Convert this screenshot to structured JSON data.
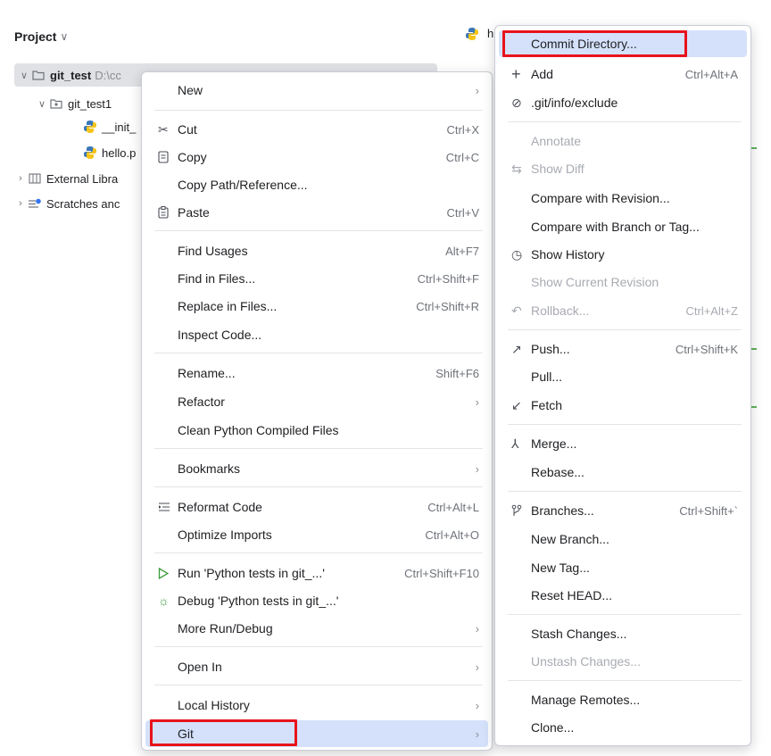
{
  "project_panel": {
    "title": "Project",
    "tree": [
      {
        "arrow": "∨",
        "label": "git_test",
        "hint": "D:\\cc",
        "icon": "folder-icon"
      },
      {
        "arrow": "∨",
        "label": "git_test1",
        "icon": "package-folder-icon"
      },
      {
        "label": "__init_",
        "icon": "python-file-icon"
      },
      {
        "label": "hello.p",
        "icon": "python-file-icon"
      },
      {
        "arrow": "›",
        "label": "External Libra",
        "icon": "library-icon"
      },
      {
        "arrow": "›",
        "label": "Scratches anc",
        "icon": "scratches-icon"
      }
    ]
  },
  "editor_tab": {
    "label": "h",
    "icon": "python-file-icon"
  },
  "context_menu": {
    "items": [
      {
        "label": "New",
        "submenu": true
      },
      {
        "label": "Cut",
        "icon": "scissors-icon",
        "shortcut": "Ctrl+X"
      },
      {
        "label": "Copy",
        "icon": "copy-icon",
        "shortcut": "Ctrl+C"
      },
      {
        "label": "Copy Path/Reference..."
      },
      {
        "label": "Paste",
        "icon": "paste-icon",
        "shortcut": "Ctrl+V"
      },
      {
        "label": "Find Usages",
        "shortcut": "Alt+F7"
      },
      {
        "label": "Find in Files...",
        "shortcut": "Ctrl+Shift+F"
      },
      {
        "label": "Replace in Files...",
        "shortcut": "Ctrl+Shift+R"
      },
      {
        "label": "Inspect Code..."
      },
      {
        "label": "Rename...",
        "shortcut": "Shift+F6"
      },
      {
        "label": "Refactor",
        "submenu": true
      },
      {
        "label": "Clean Python Compiled Files"
      },
      {
        "label": "Bookmarks",
        "submenu": true
      },
      {
        "label": "Reformat Code",
        "icon": "reformat-icon",
        "shortcut": "Ctrl+Alt+L"
      },
      {
        "label": "Optimize Imports",
        "shortcut": "Ctrl+Alt+O"
      },
      {
        "label": "Run 'Python tests in git_...'",
        "icon": "run-icon",
        "shortcut": "Ctrl+Shift+F10"
      },
      {
        "label": "Debug 'Python tests in git_...'",
        "icon": "debug-icon"
      },
      {
        "label": "More Run/Debug",
        "submenu": true
      },
      {
        "label": "Open In",
        "submenu": true
      },
      {
        "label": "Local History",
        "submenu": true
      },
      {
        "label": "Git",
        "submenu": true
      }
    ],
    "submenu_arrow": "›"
  },
  "git_menu": {
    "items": [
      {
        "label": "Commit Directory..."
      },
      {
        "label": "Add",
        "icon": "plus-icon",
        "shortcut": "Ctrl+Alt+A"
      },
      {
        "label": ".git/info/exclude",
        "icon": "exclude-icon"
      },
      {
        "label": "Annotate",
        "disabled": true
      },
      {
        "label": "Show Diff",
        "icon": "diff-icon",
        "disabled": true
      },
      {
        "label": "Compare with Revision..."
      },
      {
        "label": "Compare with Branch or Tag..."
      },
      {
        "label": "Show History",
        "icon": "history-icon"
      },
      {
        "label": "Show Current Revision",
        "disabled": true
      },
      {
        "label": "Rollback...",
        "icon": "rollback-icon",
        "shortcut": "Ctrl+Alt+Z",
        "disabled": true
      },
      {
        "label": "Push...",
        "icon": "push-icon",
        "shortcut": "Ctrl+Shift+K"
      },
      {
        "label": "Pull..."
      },
      {
        "label": "Fetch",
        "icon": "fetch-icon"
      },
      {
        "label": "Merge...",
        "icon": "merge-icon"
      },
      {
        "label": "Rebase..."
      },
      {
        "label": "Branches...",
        "icon": "branches-icon",
        "shortcut": "Ctrl+Shift+`"
      },
      {
        "label": "New Branch..."
      },
      {
        "label": "New Tag..."
      },
      {
        "label": "Reset HEAD..."
      },
      {
        "label": "Stash Changes..."
      },
      {
        "label": "Unstash Changes...",
        "disabled": true
      },
      {
        "label": "Manage Remotes..."
      },
      {
        "label": "Clone..."
      }
    ]
  },
  "colors": {
    "highlight": "#d5e1fb",
    "annotation_red": "#e8131b",
    "python_blue": "#3b77b8",
    "python_yellow": "#f5c518"
  }
}
